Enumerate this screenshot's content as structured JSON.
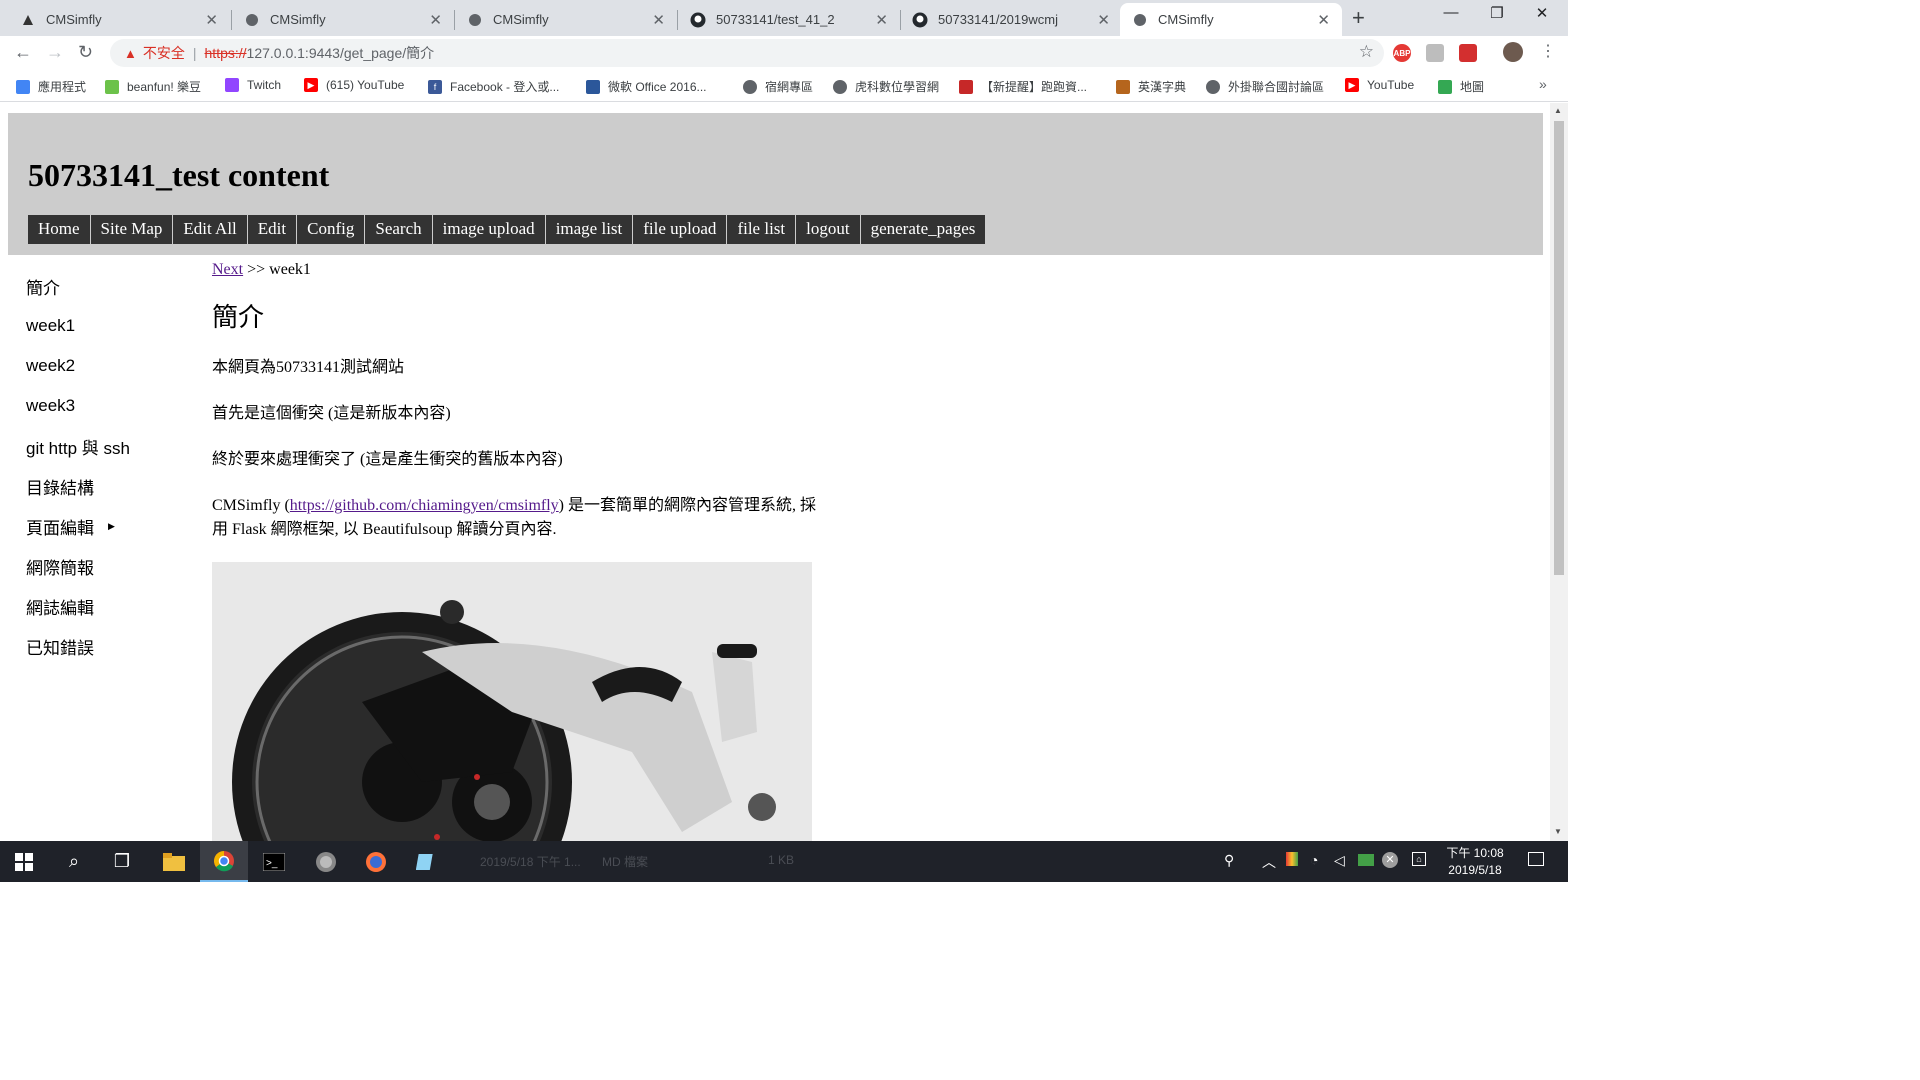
{
  "browser": {
    "tabs": [
      {
        "title": "CMSimfly",
        "favicon": "cmsimfly-logo-icon",
        "active": false
      },
      {
        "title": "CMSimfly",
        "favicon": "globe-icon",
        "active": false
      },
      {
        "title": "CMSimfly",
        "favicon": "globe-icon",
        "active": false
      },
      {
        "title": "50733141/test_41_2",
        "favicon": "github-icon",
        "active": false
      },
      {
        "title": "50733141/2019wcmj",
        "favicon": "github-icon",
        "active": false
      },
      {
        "title": "CMSimfly",
        "favicon": "globe-icon",
        "active": true
      }
    ],
    "security_label": "不安全",
    "url_scheme": "https://",
    "url_rest": "127.0.0.1:9443/get_page/簡介",
    "bookmarks": [
      {
        "label": "應用程式",
        "icon": "apps-grid-icon",
        "color": "#4285f4"
      },
      {
        "label": "beanfun! 樂豆",
        "icon": "beanfun-icon",
        "color": "#6cc24a"
      },
      {
        "label": "Twitch",
        "icon": "twitch-icon",
        "color": "#9146ff"
      },
      {
        "label": "(615) YouTube",
        "icon": "youtube-icon",
        "color": "#ff0000"
      },
      {
        "label": "Facebook - 登入或...",
        "icon": "facebook-icon",
        "color": "#3b5998"
      },
      {
        "label": "微軟 Office 2016...",
        "icon": "office-icon",
        "color": "#2b579a"
      },
      {
        "label": "宿網專區",
        "icon": "globe-icon",
        "color": "#5f6368"
      },
      {
        "label": "虎科數位學習網",
        "icon": "globe-icon",
        "color": "#5f6368"
      },
      {
        "label": "【新提醒】跑跑資...",
        "icon": "kart-icon",
        "color": "#c62828"
      },
      {
        "label": "英漢字典",
        "icon": "dictionary-icon",
        "color": "#b5651d"
      },
      {
        "label": "外掛聯合國討論區",
        "icon": "globe-icon",
        "color": "#5f6368"
      },
      {
        "label": "YouTube",
        "icon": "youtube-icon",
        "color": "#ff0000"
      },
      {
        "label": "地圖",
        "icon": "maps-icon",
        "color": "#34a853"
      }
    ]
  },
  "site": {
    "title": "50733141_test content",
    "menu": [
      "Home",
      "Site Map",
      "Edit All",
      "Edit",
      "Config",
      "Search",
      "image upload",
      "image list",
      "file upload",
      "file list",
      "logout",
      "generate_pages"
    ],
    "sidebar": [
      "簡介",
      "week1",
      "week2",
      "week3",
      "git http 與 ssh",
      "目錄結構",
      "頁面編輯",
      "網際簡報",
      "網誌編輯",
      "已知錯誤"
    ],
    "breadcrumb": {
      "next_label": "Next",
      "separator": ">>",
      "target": "week1"
    },
    "heading": "簡介",
    "paragraphs": [
      "本網頁為50733141測試網站",
      "首先是這個衝突 (這是新版本內容)",
      "終於要來處理衝突了 (這是產生衝突的舊版本內容)"
    ],
    "cms_para": {
      "prefix": "CMSimfly (",
      "link": "https://github.com/chiamingyen/cmsimfly",
      "suffix": ") 是一套簡單的網際內容管理系統, 採用 Flask 網際框架, 以 Beautifulsoup 解讀分頁內容."
    }
  },
  "taskbar": {
    "clock_time": "下午 10:08",
    "clock_date": "2019/5/18"
  }
}
